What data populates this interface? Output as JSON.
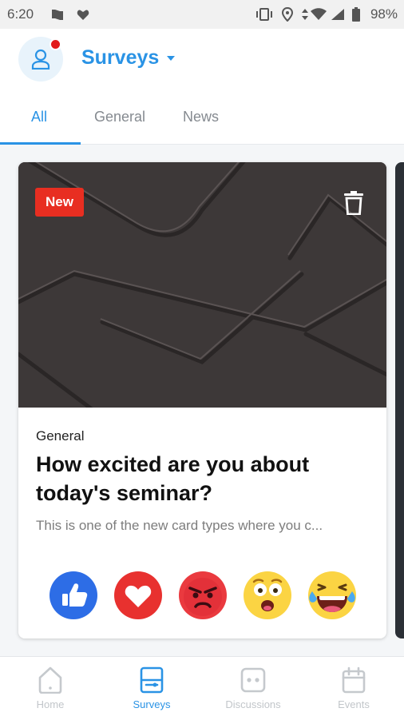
{
  "status_bar": {
    "time": "6:20",
    "battery": "98%"
  },
  "header": {
    "title": "Surveys",
    "notification_color": "#e21b1b"
  },
  "tabs": [
    {
      "label": "All",
      "active": true
    },
    {
      "label": "General",
      "active": false
    },
    {
      "label": "News",
      "active": false
    }
  ],
  "card": {
    "badge": "New",
    "category": "General",
    "question": "How excited are you about today's seminar?",
    "description": "This is one of the new card types where you c...",
    "reactions": [
      "thumbs-up-icon",
      "heart-icon",
      "angry-face-icon",
      "shocked-face-icon",
      "laughing-face-icon"
    ]
  },
  "bottom_nav": [
    {
      "label": "Home",
      "icon": "home-icon",
      "active": false
    },
    {
      "label": "Surveys",
      "icon": "surveys-icon",
      "active": true
    },
    {
      "label": "Discussions",
      "icon": "discussions-icon",
      "active": false
    },
    {
      "label": "Events",
      "icon": "events-icon",
      "active": false
    }
  ],
  "colors": {
    "accent": "#2a93e5",
    "badge": "#e82e21"
  }
}
